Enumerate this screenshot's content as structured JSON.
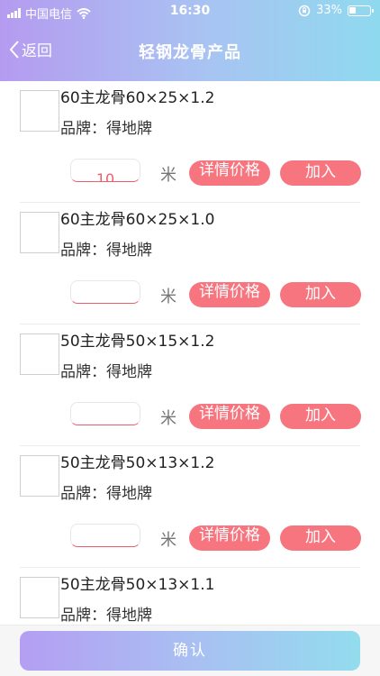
{
  "status_bar": {
    "carrier": "中国电信",
    "time": "16:30",
    "battery": "33%",
    "battery_level": 0.33
  },
  "nav": {
    "back_label": "返回",
    "title": "轻钢龙骨产品"
  },
  "brand_label": "品牌：",
  "unit_label": "米",
  "detail_label": "详情价格",
  "add_label": "加入",
  "items": [
    {
      "name": "60主龙骨60×25×1.2",
      "brand": "得地牌",
      "quantity": "10"
    },
    {
      "name": "60主龙骨60×25×1.0",
      "brand": "得地牌",
      "quantity": ""
    },
    {
      "name": "50主龙骨50×15×1.2",
      "brand": "得地牌",
      "quantity": ""
    },
    {
      "name": "50主龙骨50×13×1.2",
      "brand": "得地牌",
      "quantity": ""
    },
    {
      "name": "50主龙骨50×13×1.1",
      "brand": "得地牌",
      "quantity": ""
    }
  ],
  "confirm_label": "确认",
  "colors": {
    "accent": "#f7757f",
    "header_start": "#b59bf0",
    "header_end": "#8fd9ef"
  }
}
